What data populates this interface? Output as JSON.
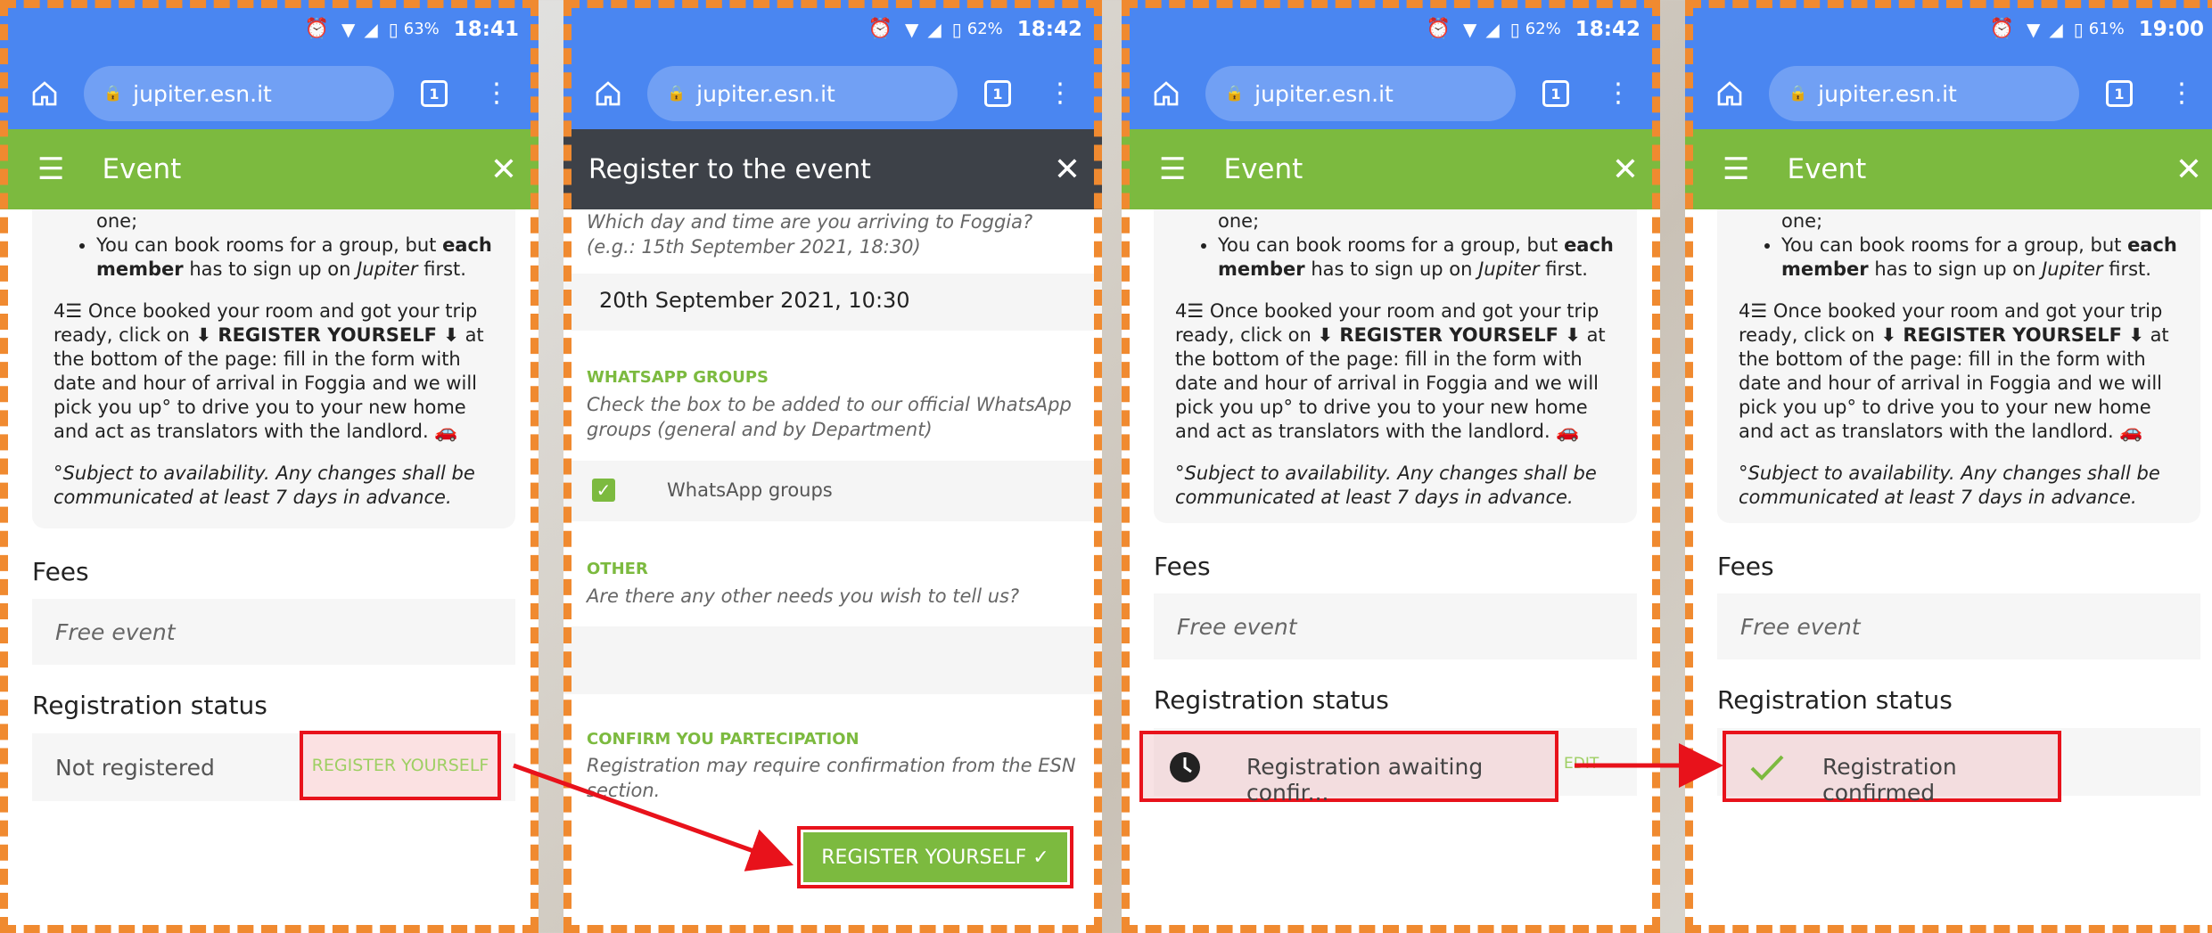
{
  "colors": {
    "accent": "#7cba3f",
    "browser_bar": "#4a86f1",
    "dialog_bar": "#3d4148",
    "highlight_border": "#e8121b",
    "dash_border": "#f08a30"
  },
  "phones": [
    {
      "status": {
        "battery": "63%",
        "time": "18:41"
      },
      "browser": {
        "url": "jupiter.esn.it",
        "tabs": "1"
      },
      "appbar": {
        "title": "Event"
      },
      "content": {
        "list_item_tail": "one;",
        "group_text_pre": "You can book rooms for a group, but ",
        "group_bold": "each member",
        "group_mid": " has to sign up on ",
        "group_ital": "Jupiter",
        "group_end": " first.",
        "step_num": "4",
        "step_text_1": "Once booked your room and got your trip ready, click on ",
        "step_bold": "⬇ REGISTER YOURSELF ⬇",
        "step_text_2": " at the bottom of the page: fill in the form with date and hour of arrival in Foggia and we will pick you up° to drive you to your new home and act as translators with the landlord. 🚗",
        "footnote": "°Subject to availability. Any changes shall be communicated at least 7 days in advance.",
        "fees_title": "Fees",
        "fees_value": "Free event",
        "status_title": "Registration status",
        "status_value": "Not registered",
        "register_button": "REGISTER YOURSELF"
      }
    },
    {
      "status": {
        "battery": "62%",
        "time": "18:42"
      },
      "browser": {
        "url": "jupiter.esn.it",
        "tabs": "1"
      },
      "appbar": {
        "title": "Register to the event"
      },
      "form": {
        "arrival_help": "Which day and time are you arriving to Foggia? (e.g.: 15th September 2021, 18:30)",
        "arrival_value": "20th September 2021, 10:30",
        "whatsapp_label": "WHATSAPP GROUPS",
        "whatsapp_help": "Check the box to be added to our official WhatsApp groups (general and by Department)",
        "whatsapp_option": "WhatsApp groups",
        "other_label": "OTHER",
        "other_help": "Are there any other needs you wish to tell us?",
        "other_value": "",
        "confirm_label": "CONFIRM YOU PARTECIPATION",
        "confirm_help": "Registration may require confirmation from the ESN section.",
        "submit_button": "REGISTER YOURSELF ✓"
      }
    },
    {
      "status": {
        "battery": "62%",
        "time": "18:42"
      },
      "browser": {
        "url": "jupiter.esn.it",
        "tabs": "1"
      },
      "appbar": {
        "title": "Event"
      },
      "status_value": "Registration awaiting confir...",
      "edit_label": "EDIT"
    },
    {
      "status": {
        "battery": "61%",
        "time": "19:00"
      },
      "browser": {
        "url": "jupiter.esn.it",
        "tabs": "1"
      },
      "appbar": {
        "title": "Event"
      },
      "status_value": "Registration confirmed"
    }
  ]
}
